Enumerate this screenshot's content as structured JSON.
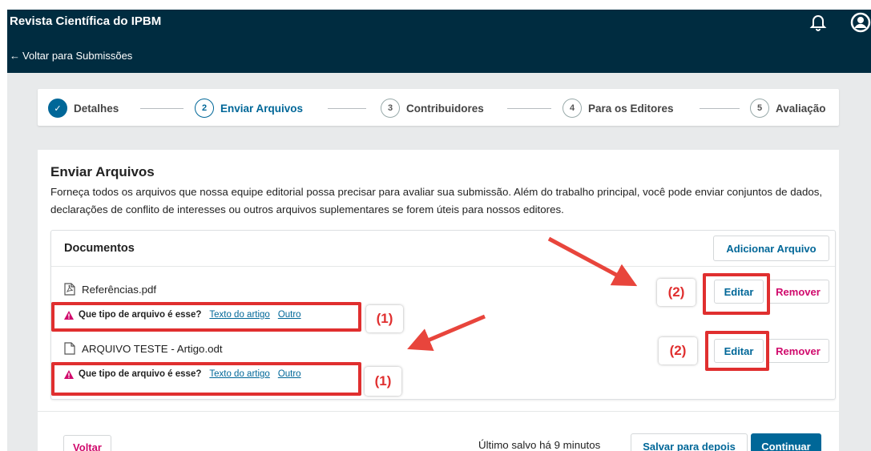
{
  "header": {
    "site_title": "Revista Científica do IPBM",
    "back_label": "Voltar para Submissões",
    "back_arrow": "←"
  },
  "stepper": {
    "steps": [
      {
        "number": "✓",
        "label": "Detalhes",
        "state": "done"
      },
      {
        "number": "2",
        "label": "Enviar Arquivos",
        "state": "active"
      },
      {
        "number": "3",
        "label": "Contribuidores",
        "state": "pending"
      },
      {
        "number": "4",
        "label": "Para os Editores",
        "state": "pending"
      },
      {
        "number": "5",
        "label": "Avaliação",
        "state": "pending"
      }
    ]
  },
  "upload": {
    "title": "Enviar Arquivos",
    "description": "Forneça todos os arquivos que nossa equipe editorial possa precisar para avaliar sua submissão. Além do trabalho principal, você pode enviar conjuntos de dados, declarações de conflito de interesses ou outros arquivos suplementares se forem úteis para nossos editores.",
    "documents_title": "Documentos",
    "add_file_label": "Adicionar Arquivo",
    "files": [
      {
        "name": "Referências.pdf",
        "icon": "pdf-file-icon"
      },
      {
        "name": "ARQUIVO TESTE - Artigo.odt",
        "icon": "document-file-icon"
      }
    ],
    "filetype_question": "Que tipo de arquivo é esse?",
    "filetype_option_text": "Texto do artigo",
    "filetype_option_other": "Outro",
    "edit_label": "Editar",
    "remove_label": "Remover"
  },
  "annotations": {
    "label_1": "(1)",
    "label_2": "(2)"
  },
  "footer": {
    "back_label": "Voltar",
    "saved_status": "Último salvo há 9 minutos",
    "save_later_label": "Salvar para depois",
    "continue_label": "Continuar"
  },
  "colors": {
    "header_bg": "#002c40",
    "primary": "#006798",
    "danger": "#d00a6c",
    "annotation_red": "#e02f2f"
  }
}
